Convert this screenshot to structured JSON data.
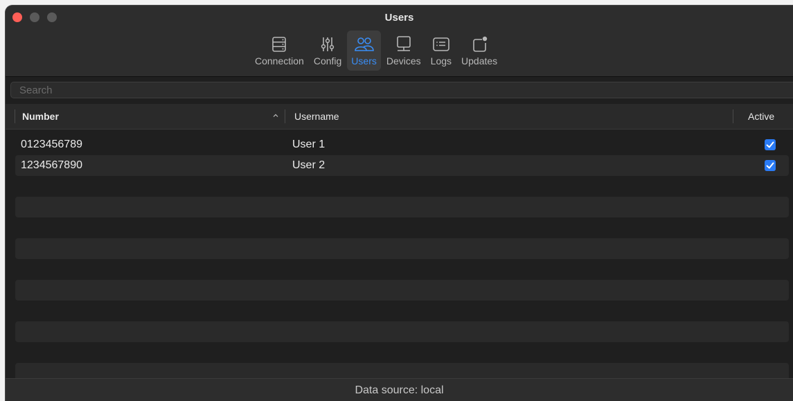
{
  "window": {
    "title": "Users"
  },
  "toolbar": {
    "items": [
      {
        "label": "Connection",
        "icon": "server-icon",
        "active": false
      },
      {
        "label": "Config",
        "icon": "sliders-icon",
        "active": false
      },
      {
        "label": "Users",
        "icon": "users-icon",
        "active": true
      },
      {
        "label": "Devices",
        "icon": "monitor-icon",
        "active": false
      },
      {
        "label": "Logs",
        "icon": "list-icon",
        "active": false
      },
      {
        "label": "Updates",
        "icon": "badge-square-icon",
        "active": false
      }
    ],
    "active_color": "#3a8ef6"
  },
  "search": {
    "placeholder": "Search",
    "value": ""
  },
  "table": {
    "columns": [
      {
        "label": "Number",
        "sort": "ascending"
      },
      {
        "label": "Username"
      },
      {
        "label": "Active"
      }
    ],
    "rows": [
      {
        "number": "0123456789",
        "username": "User 1",
        "active": true
      },
      {
        "number": "1234567890",
        "username": "User 2",
        "active": true
      }
    ],
    "checkbox_color": "#2a7bf5"
  },
  "status": {
    "text": "Data source: local"
  }
}
